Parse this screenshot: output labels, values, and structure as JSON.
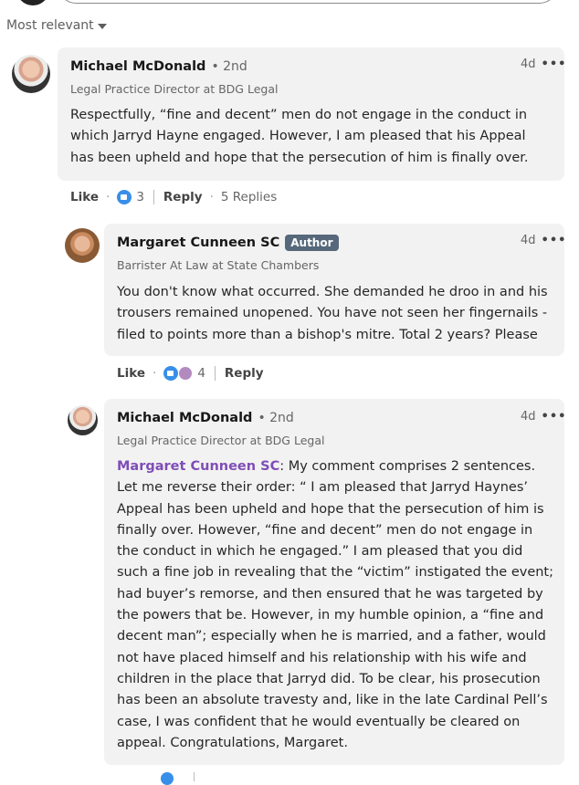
{
  "sort": {
    "label": "Most relevant",
    "icon": "caret-down-icon"
  },
  "comments": [
    {
      "author": "Michael McDonald",
      "degree": "• 2nd",
      "headline": "Legal Practice Director at BDG Legal",
      "time": "4d",
      "more_icon": "•••",
      "body": "Respectfully, “fine and decent” men do not engage in the conduct in which Jarryd Hayne engaged. However, I am pleased that his Appeal has been upheld and hope that the persecution of him is finally over.",
      "actions": {
        "like": "Like",
        "reaction_count": "3",
        "reply": "Reply",
        "replies": "5 Replies"
      }
    },
    {
      "author": "Margaret Cunneen SC",
      "badge": "Author",
      "headline": "Barrister At Law at State Chambers",
      "time": "4d",
      "more_icon": "•••",
      "body": "You don't know what occurred. She demanded he droo in and his trousers remained unopened. You have not seen her fingernails - filed to points more than a bishop's mitre. Total 2 years? Please",
      "actions": {
        "like": "Like",
        "reaction_count": "4",
        "reply": "Reply"
      }
    },
    {
      "author": "Michael McDonald",
      "degree": "• 2nd",
      "headline": "Legal Practice Director at BDG Legal",
      "time": "4d",
      "more_icon": "•••",
      "mention": "Margaret Cunneen SC",
      "body": ": My comment comprises 2 sentences. Let me reverse their order: “ I am pleased that Jarryd Haynes’ Appeal has been upheld and hope that the persecution of him is finally over. However, “fine and decent” men do not engage in the conduct in which he engaged.” I am pleased that you did such a fine job in revealing that the “victim” instigated the event; had buyer’s remorse, and then ensured that he was targeted by the powers that be. However, in my humble opinion, a “fine and decent man”; especially when he is married, and a father, would not have placed himself and his relationship with his wife and children in the place that Jarryd did. To be clear, his prosecution has been an absolute travesty and, like in the late Cardinal Pell’s case, I was confident that he would eventually be cleared on appeal. Congratulations, Margaret."
    }
  ]
}
